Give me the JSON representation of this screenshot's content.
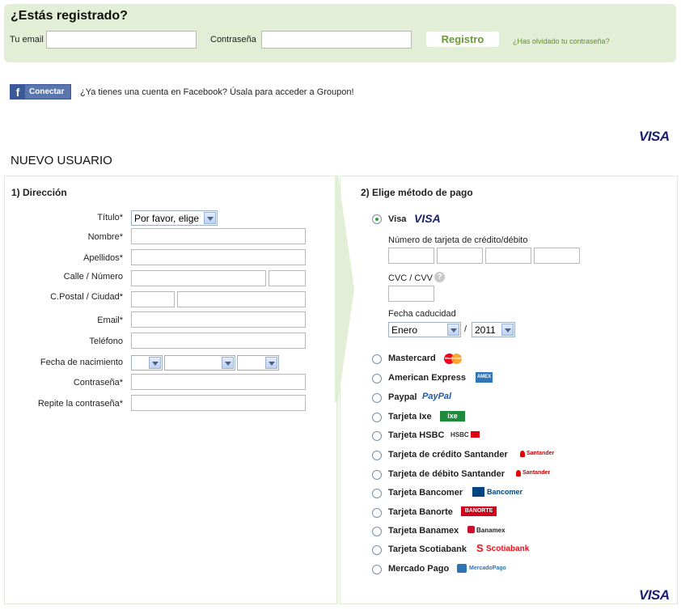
{
  "login": {
    "title": "¿Estás registrado?",
    "email_label": "Tu email",
    "email_value": "",
    "password_label": "Contraseña",
    "password_value": "",
    "register_button": "Registro",
    "forgot_link": "¿Has olvidado tu contraseña?"
  },
  "facebook": {
    "button_label": "Conectar",
    "message": "¿Ya tienes una cuenta en Facebook? Úsala para acceder a Groupon!"
  },
  "visa_logo": "VISA",
  "new_user_heading": "NUEVO USUARIO",
  "address": {
    "heading": "1) Dirección",
    "title_label": "Título*",
    "title_select": "Por favor, elige",
    "name_label": "Nombre*",
    "lastname_label": "Apellidos*",
    "street_label": "Calle  /  Número",
    "postal_label": "C.Postal  /  Ciudad*",
    "email_label": "Email*",
    "phone_label": "Teléfono",
    "birth_label": "Fecha de nacimiento",
    "password_label": "Contraseña*",
    "repeat_password_label": "Repite la contraseña*"
  },
  "payment": {
    "heading": "2) Elige método de pago",
    "visa_option": "Visa",
    "visa_logo": "VISA",
    "card_number_label": "Número de tarjeta de crédito/débito",
    "cvc_label": "CVC / CVV",
    "help_icon": "?",
    "expiry_label": "Fecha caducidad",
    "month": "Enero",
    "slash": "/",
    "year": "2011",
    "methods": [
      {
        "label": "Mastercard",
        "logo": "MasterCard"
      },
      {
        "label": "American Express",
        "logo": "AMEX"
      },
      {
        "label": "Paypal",
        "logo": "PayPal"
      },
      {
        "label": "Tarjeta Ixe",
        "logo": "ixe"
      },
      {
        "label": "Tarjeta HSBC",
        "logo": "HSBC"
      },
      {
        "label": "Tarjeta de crédito Santander",
        "logo": "Santander"
      },
      {
        "label": "Tarjeta de débito Santander",
        "logo": "Santander"
      },
      {
        "label": "Tarjeta Bancomer",
        "logo": "Bancomer"
      },
      {
        "label": "Tarjeta Banorte",
        "logo": "BANORTE"
      },
      {
        "label": "Tarjeta Banamex",
        "logo": "Banamex"
      },
      {
        "label": "Tarjeta Scotiabank",
        "logo": "Scotiabank"
      },
      {
        "label": "Mercado Pago",
        "logo": "MercadoPago"
      }
    ],
    "footer_logo": "VISA"
  },
  "colors": {
    "login_bg": "#e2efd6",
    "register_text": "#6b9a3a",
    "link": "#5e8e2a",
    "facebook": "#3b5998",
    "visa": "#1a1f71"
  }
}
